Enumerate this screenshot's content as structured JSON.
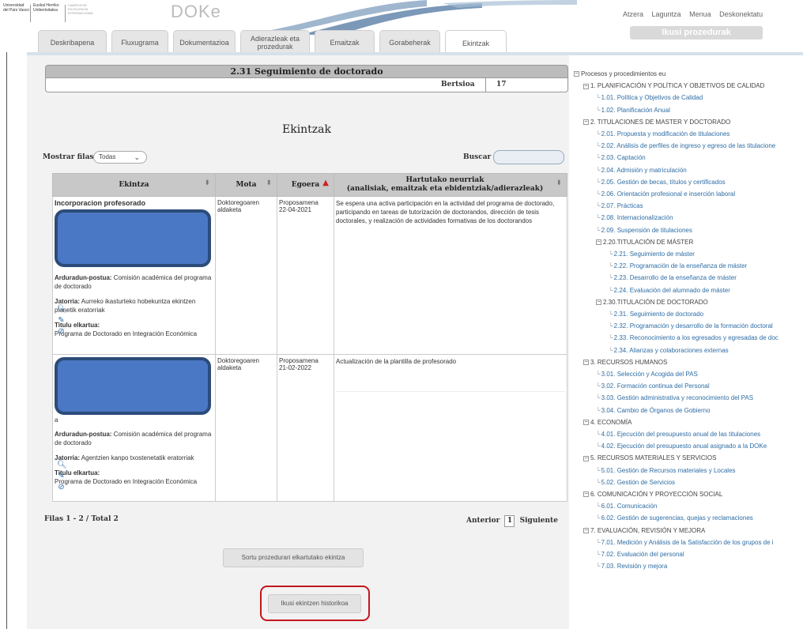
{
  "header": {
    "logo_university": [
      "Universidad",
      "del País Vasco"
    ],
    "logo_university_eu": [
      "Euskal Herriko",
      "Unibertsitatea"
    ],
    "logo_campus": [
      "CAMPUS DE",
      "EXCELENCIA",
      "INTERNACIONAL"
    ],
    "brand": "DOKe",
    "top_links": [
      "Atzera",
      "Laguntza",
      "Menua",
      "Deskonektatu"
    ],
    "ikusi_label": "Ikusi prozedurak"
  },
  "tabs": [
    {
      "label": "Deskribapena"
    },
    {
      "label": "Fluxugrama"
    },
    {
      "label": "Dokumentazioa"
    },
    {
      "label": "Adierazleak eta prozedurak"
    },
    {
      "label": "Emaitzak"
    },
    {
      "label": "Gorabeherak"
    },
    {
      "label": "Ekintzak",
      "active": true
    }
  ],
  "main": {
    "title": "2.31 Seguimiento de doctorado",
    "version_label": "Bertsioa",
    "version": "17",
    "section_title": "Ekintzak",
    "mostrar_label": "Mostrar filas",
    "mostrar_value": "Todas",
    "buscar_label": "Buscar",
    "columns": [
      "Ekintza",
      "Mota",
      "Egoera",
      "Hartutako neurriak",
      "(analisiak, emaitzak eta ebidentziak/adierazleak)"
    ],
    "rows": [
      {
        "title": "Incorporacion profesorado",
        "responsible_label": "Arduradun-postua:",
        "responsible": "Comisión académica del programa de doctorado",
        "source_label": "Jatorria:",
        "source": "Aurreko ikasturteko hobekuntza ekintzen planetik eratorriak",
        "title_label": "Titulu elkartua:",
        "title_value": "Programa de Doctorado en Integración Económica",
        "type": "Doktoregoaren aldaketa",
        "status": "Proposamena",
        "date": "22-04-2021",
        "measures": "Se espera una activa participación en la actividad del programa de doctorado, participando en tareas de tutorización de doctorandos, dirección de tesis doctorales, y realización de actividades formativas de los doctorandos"
      },
      {
        "title": "",
        "partial": "a",
        "responsible_label": "Arduradun-postua:",
        "responsible": "Comisión académica del programa de doctorado",
        "source_label": "Jatorria:",
        "source": "Agentzien kanpo txostenetatik eratorriak",
        "title_label": "Titulu elkartua:",
        "title_value": "Programa de Doctorado en Integración Económica",
        "type": "Doktoregoaren aldaketa",
        "status": "Proposamena",
        "date": "21-02-2022",
        "measures": "Actualización de la plantilla de profesorado"
      }
    ],
    "filas_label": "Filas 1 - 2 / Total 2",
    "anterior": "Anterior",
    "page": "1",
    "siguiente": "Siguiente",
    "btn_sortu": "Sortu prozedurari elkartutako ekintza",
    "btn_historikoa": "Ikusi ekintzen historikoa"
  },
  "tree": {
    "root": "Procesos y procedimientos eu",
    "items": [
      {
        "text": "1. PLANIFICACIÓN Y POLÍTICA Y OBJETIVOS DE CALIDAD",
        "level": 1,
        "kind": "group"
      },
      {
        "text": "1.01. Política y Objetivos de Calidad",
        "level": 2
      },
      {
        "text": "1.02. Planificación Anual",
        "level": 2
      },
      {
        "text": "2. TITULACIONES DE MASTER Y DOCTORADO",
        "level": 1,
        "kind": "group"
      },
      {
        "text": "2.01. Propuesta y modificación de titulaciones",
        "level": 2
      },
      {
        "text": "2.02. Análisis de perfiles de ingreso y egreso de las titulacione",
        "level": 2
      },
      {
        "text": "2.03. Captación",
        "level": 2
      },
      {
        "text": "2.04. Admisión y matriculación",
        "level": 2
      },
      {
        "text": "2.05. Gestión de becas, títulos y certificados",
        "level": 2
      },
      {
        "text": "2.06. Orientación profesional e inserción laboral",
        "level": 2
      },
      {
        "text": "2.07. Prácticas",
        "level": 2
      },
      {
        "text": "2.08. Internacionalización",
        "level": 2
      },
      {
        "text": "2.09. Suspensión de titulaciones",
        "level": 2
      },
      {
        "text": "2.20.TITULACIÓN DE MÁSTER",
        "level": 2,
        "kind": "group"
      },
      {
        "text": "2.21. Seguimiento de máster",
        "level": 3
      },
      {
        "text": "2.22. Programación de la enseñanza de máster",
        "level": 3
      },
      {
        "text": "2.23. Desarrollo de la enseñanza de máster",
        "level": 3
      },
      {
        "text": "2.24. Evaluación del alumnado de máster",
        "level": 3
      },
      {
        "text": "2.30.TITULACIÓN DE DOCTORADO",
        "level": 2,
        "kind": "group"
      },
      {
        "text": "2.31. Seguimiento de doctorado",
        "level": 3
      },
      {
        "text": "2.32. Programación y desarrollo de la formación doctoral",
        "level": 3
      },
      {
        "text": "2.33. Reconocimiento a los egresados y egresadas de doc",
        "level": 3
      },
      {
        "text": "2.34. Alianzas y colaboraciones externas",
        "level": 3
      },
      {
        "text": "3. RECURSOS HUMANOS",
        "level": 1,
        "kind": "group"
      },
      {
        "text": "3.01. Selección y Acogida del PAS",
        "level": 2
      },
      {
        "text": "3.02. Formación continua del Personal",
        "level": 2
      },
      {
        "text": "3.03. Gestión administrativa y reconocimiento del PAS",
        "level": 2
      },
      {
        "text": "3.04. Cambio de Órganos de Gobierno",
        "level": 2
      },
      {
        "text": "4. ECONOMÍA",
        "level": 1,
        "kind": "group"
      },
      {
        "text": "4.01. Ejecución del presupuesto anual de las titulaciones",
        "level": 2
      },
      {
        "text": "4.02. Ejecución del presupuesto anual asignado a la DOKe",
        "level": 2
      },
      {
        "text": "5. RECURSOS MATERIALES Y SERVICIOS",
        "level": 1,
        "kind": "group"
      },
      {
        "text": "5.01. Gestión de Recursos materiales y Locales",
        "level": 2
      },
      {
        "text": "5.02. Gestión de Servicios",
        "level": 2
      },
      {
        "text": "6. COMUNICACIÓN Y PROYECCIÓN SOCIAL",
        "level": 1,
        "kind": "group"
      },
      {
        "text": "6.01. Comunicación",
        "level": 2
      },
      {
        "text": "6.02. Gestión de sugerencias, quejas y reclamaciones",
        "level": 2
      },
      {
        "text": "7. EVALUACIÓN, REVISIÓN Y MEJORA",
        "level": 1,
        "kind": "group"
      },
      {
        "text": "7.01. Medición y Análisis de la Satisfacción de los grupos de i",
        "level": 2
      },
      {
        "text": "7.02. Evaluación del personal",
        "level": 2
      },
      {
        "text": "7.03. Revisión y mejora",
        "level": 2
      }
    ]
  },
  "colors": {
    "link": "#2e6da4",
    "highlight_border": "#c4161c",
    "redaction": "#4b78c4"
  }
}
